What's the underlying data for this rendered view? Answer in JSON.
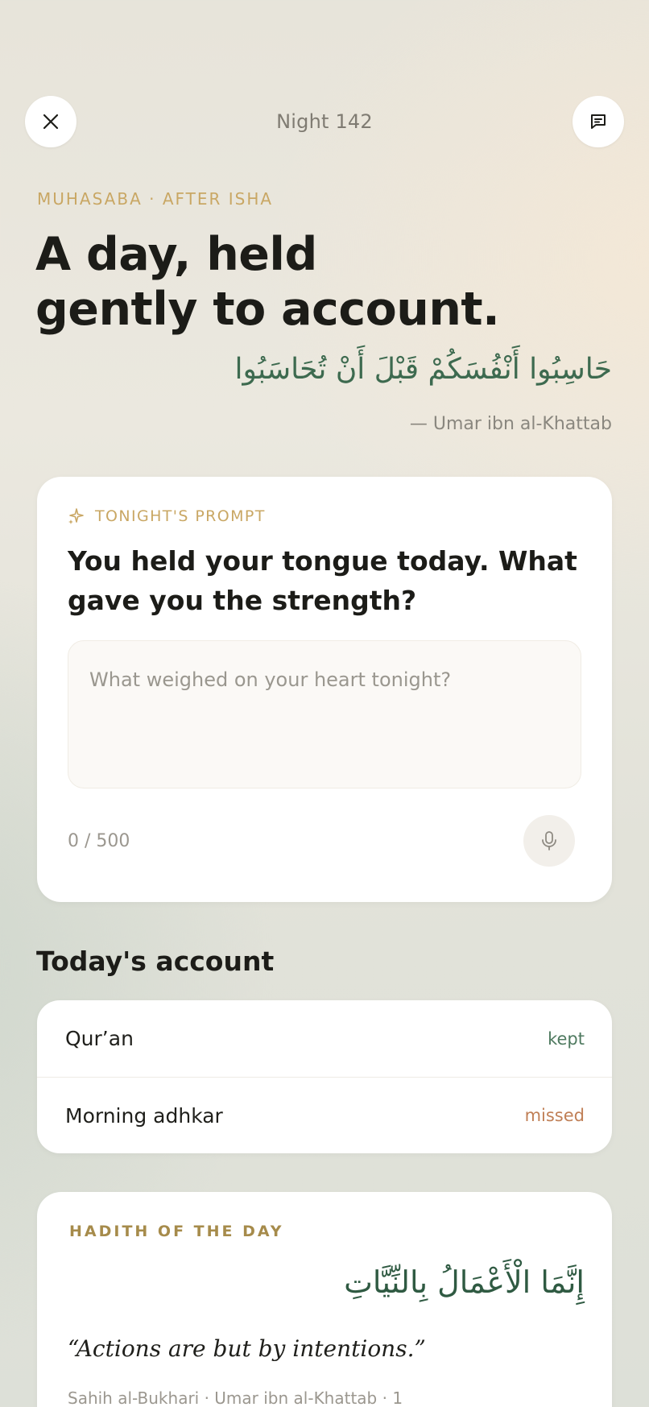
{
  "header": {
    "night_label": "Night 142",
    "close_icon": "close-icon",
    "note_icon": "message-square-icon"
  },
  "hero": {
    "eyebrow": "MUHASABA · AFTER ISHA",
    "title_line1": "A day, held",
    "title_line2": "gently to account.",
    "quote_arabic": "حَاسِبُوا أَنْفُسَكُمْ قَبْلَ أَنْ تُحَاسَبُوا",
    "quote_attribution": "— Umar ibn al-Khattab"
  },
  "prompt": {
    "label": "TONIGHT'S PROMPT",
    "label_icon": "sparkle-icon",
    "question": "You held your tongue today. What gave you the strength?",
    "input_value": "",
    "input_placeholder": "What weighed on your heart tonight?",
    "char_count": "0 / 500",
    "mic_icon": "microphone-icon"
  },
  "account": {
    "title": "Today's account",
    "items": [
      {
        "name": "Qur’an",
        "status": "kept"
      },
      {
        "name": "Morning adhkar",
        "status": "missed"
      }
    ]
  },
  "hadith": {
    "label": "HADITH OF THE DAY",
    "arabic": "إِنَّمَا الْأَعْمَالُ بِالنِّيَّاتِ",
    "english": "“Actions are but by intentions.”",
    "source": "Sahih al-Bukhari · Umar ibn al-Khattab · 1"
  },
  "colors": {
    "accent_gold": "#c9a764",
    "accent_green": "#3d6a4f",
    "status_kept": "#4f7a60",
    "status_missed": "#c07f56"
  }
}
